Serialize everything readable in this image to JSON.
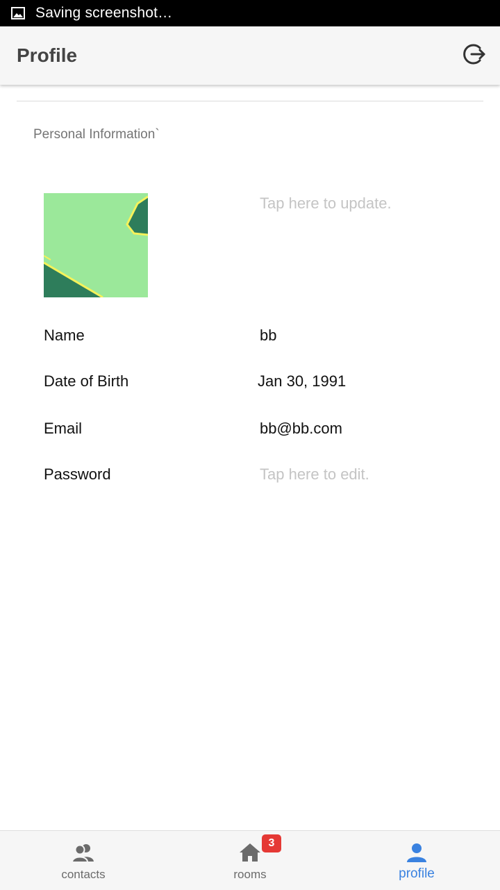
{
  "status_bar": {
    "icon": "image-icon",
    "text": "Saving screenshot…"
  },
  "app_bar": {
    "title": "Profile",
    "action_icon": "logout-icon"
  },
  "section": {
    "title": "Personal Information`"
  },
  "avatar": {
    "update_hint": "Tap here to update."
  },
  "fields": {
    "name": {
      "label": "Name",
      "value": "bb"
    },
    "dob": {
      "label": "Date of Birth",
      "value": "Jan 30, 1991"
    },
    "email": {
      "label": "Email",
      "value": "bb@bb.com"
    },
    "password": {
      "label": "Password",
      "value": "Tap here to edit."
    }
  },
  "bottom_nav": {
    "items": [
      {
        "label": "contacts",
        "icon": "contacts-icon",
        "active": false
      },
      {
        "label": "rooms",
        "icon": "home-icon",
        "active": false,
        "badge": "3"
      },
      {
        "label": "profile",
        "icon": "person-icon",
        "active": true
      }
    ]
  },
  "colors": {
    "accent": "#3a82e0",
    "badge": "#e53935",
    "placeholder": "#c4c4c4"
  }
}
